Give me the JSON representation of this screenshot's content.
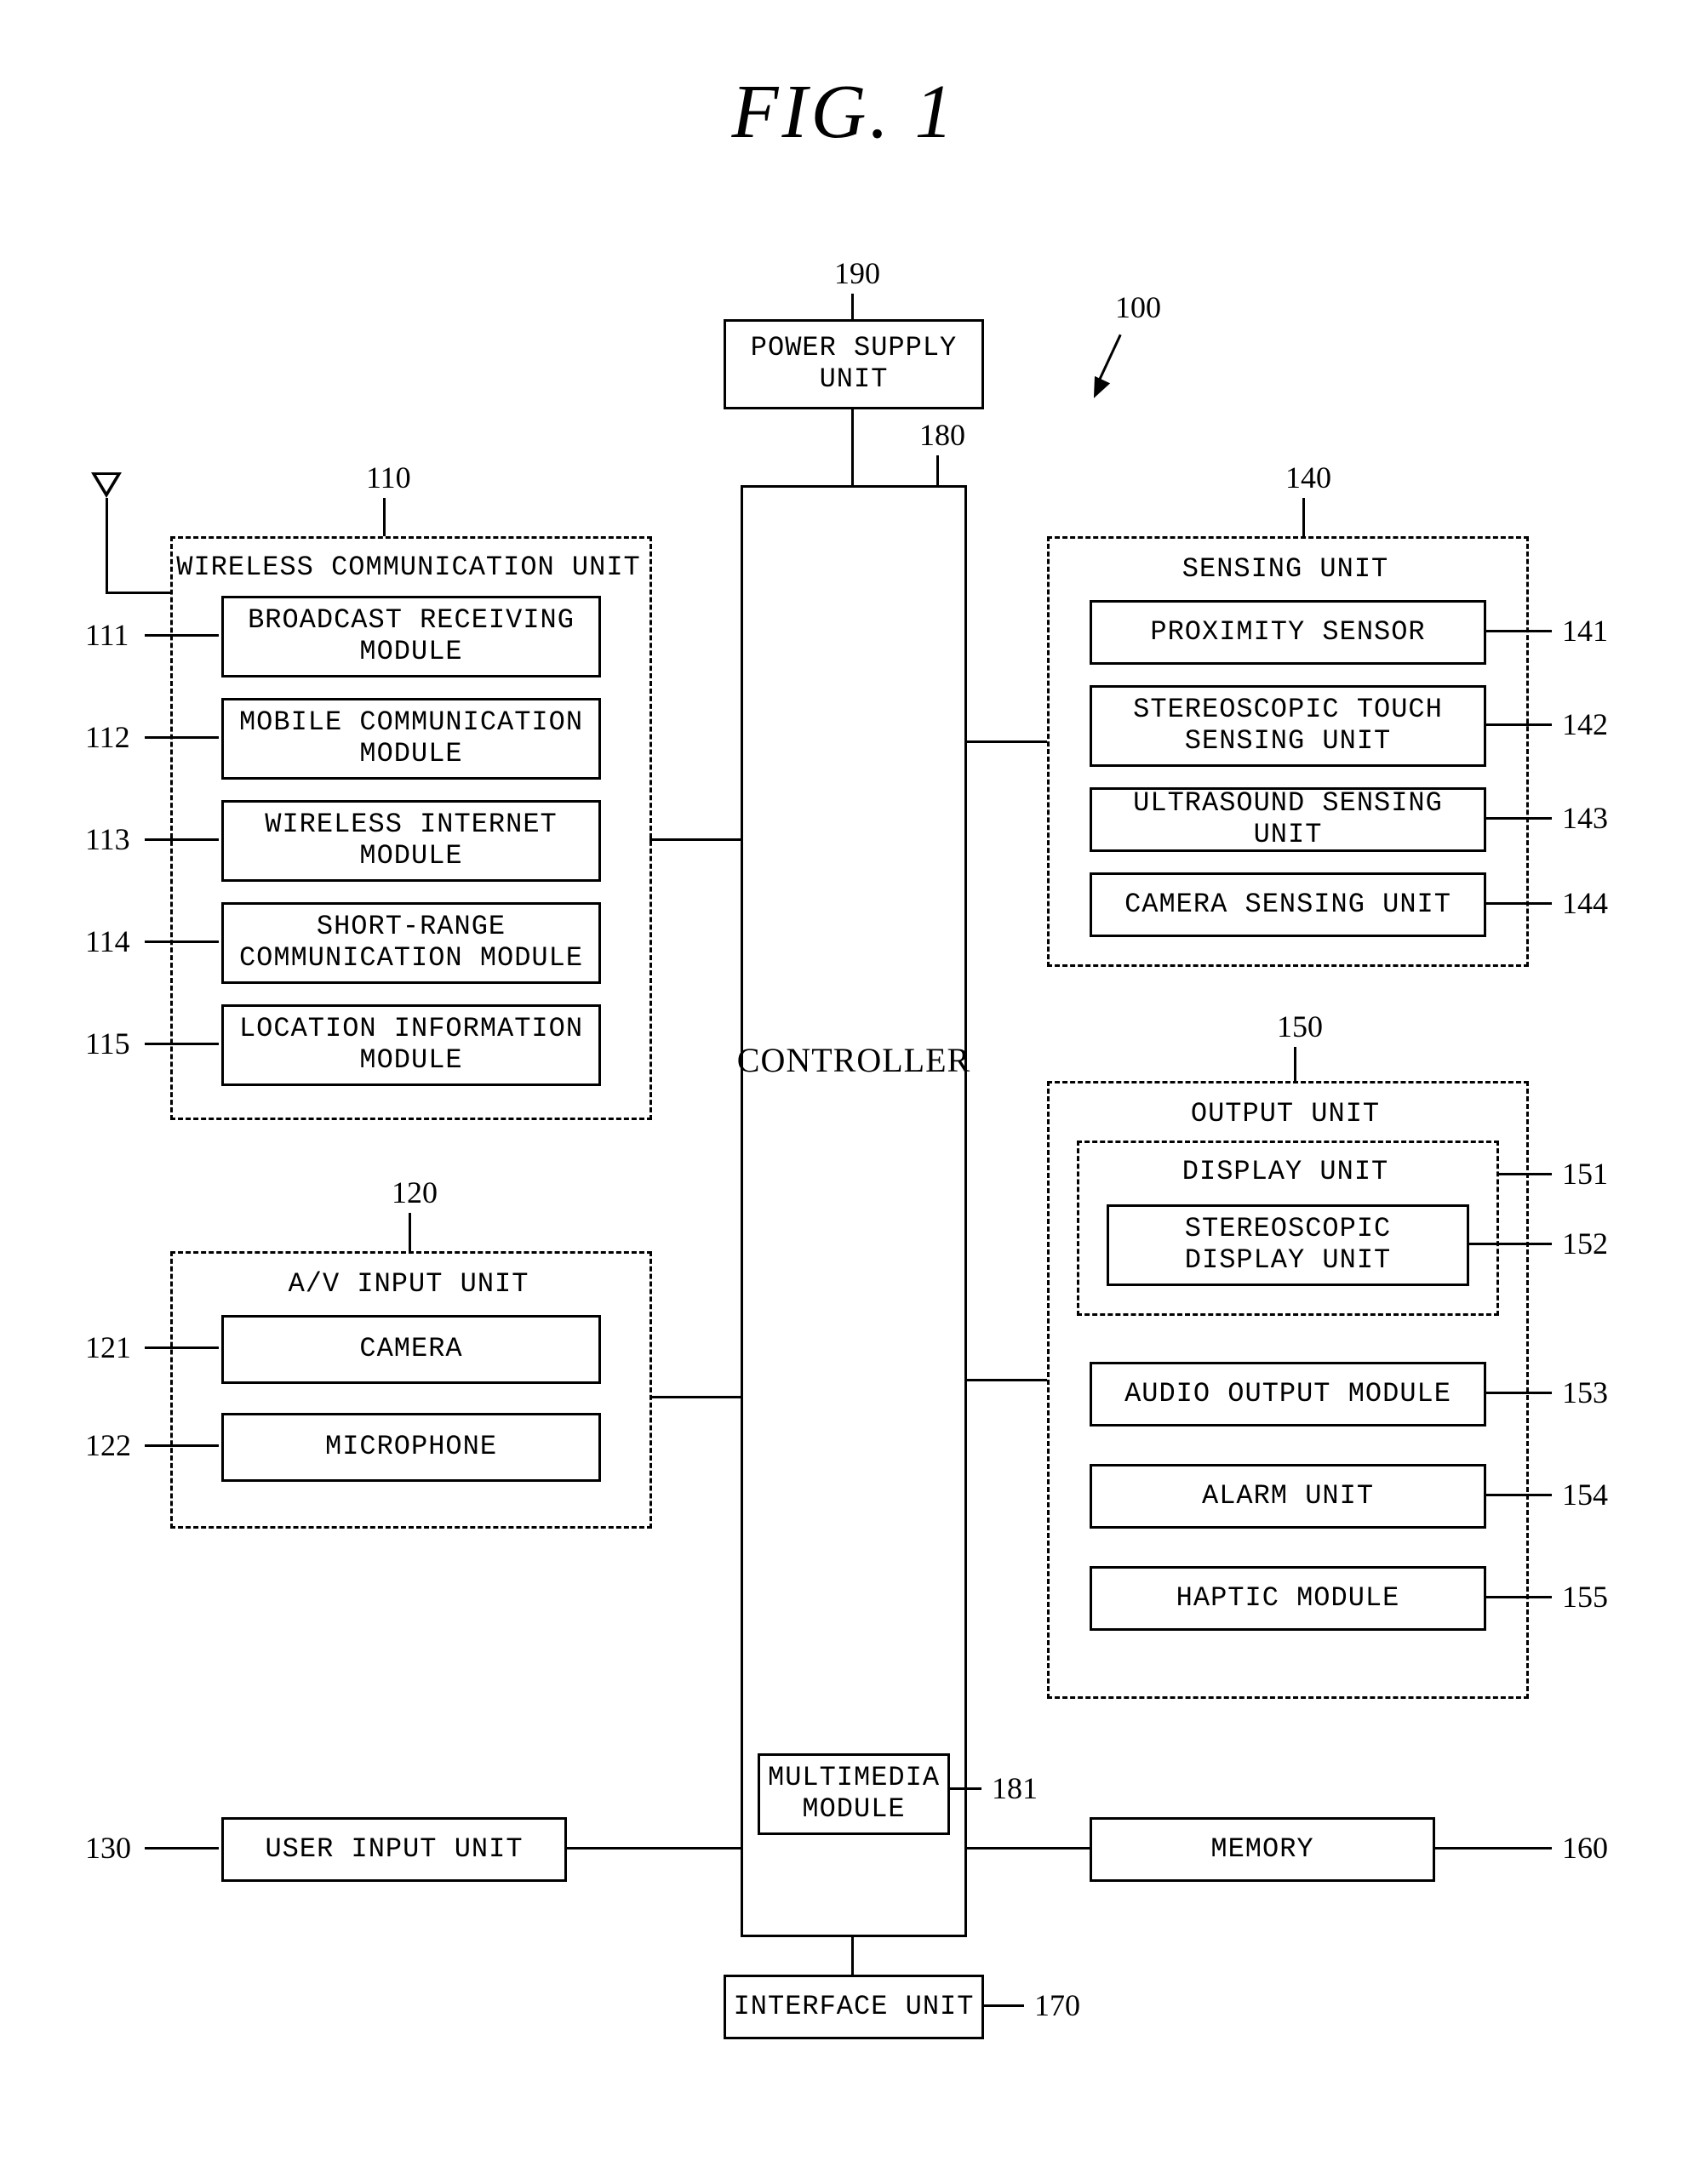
{
  "title": "FIG. 1",
  "refs": {
    "device": "100",
    "psu": "190",
    "ctrl": "180",
    "wcu": "110",
    "wcu_111": "111",
    "wcu_112": "112",
    "wcu_113": "113",
    "wcu_114": "114",
    "wcu_115": "115",
    "av": "120",
    "av_121": "121",
    "av_122": "122",
    "uinput": "130",
    "sense": "140",
    "sense_141": "141",
    "sense_142": "142",
    "sense_143": "143",
    "sense_144": "144",
    "out": "150",
    "out_151": "151",
    "out_152": "152",
    "out_153": "153",
    "out_154": "154",
    "out_155": "155",
    "mem": "160",
    "if": "170",
    "mm": "181"
  },
  "labels": {
    "psu": "POWER SUPPLY\nUNIT",
    "ctrl": "CONTROLLER",
    "mm": "MULTIMEDIA\nMODULE",
    "uinput": "USER INPUT UNIT",
    "mem": "MEMORY",
    "if": "INTERFACE UNIT",
    "wcu_title": "WIRELESS COMMUNICATION UNIT",
    "wcu_111": "BROADCAST RECEIVING\nMODULE",
    "wcu_112": "MOBILE COMMUNICATION\nMODULE",
    "wcu_113": "WIRELESS INTERNET\nMODULE",
    "wcu_114": "SHORT-RANGE\nCOMMUNICATION MODULE",
    "wcu_115": "LOCATION INFORMATION\nMODULE",
    "av_title": "A/V INPUT UNIT",
    "av_121": "CAMERA",
    "av_122": "MICROPHONE",
    "sense_title": "SENSING UNIT",
    "sense_141": "PROXIMITY SENSOR",
    "sense_142": "STEREOSCOPIC TOUCH\nSENSING UNIT",
    "sense_143": "ULTRASOUND SENSING UNIT",
    "sense_144": "CAMERA SENSING UNIT",
    "out_title": "OUTPUT UNIT",
    "disp_title": "DISPLAY UNIT",
    "out_152": "STEREOSCOPIC\nDISPLAY UNIT",
    "out_153": "AUDIO OUTPUT MODULE",
    "out_154": "ALARM UNIT",
    "out_155": "HAPTIC MODULE"
  }
}
